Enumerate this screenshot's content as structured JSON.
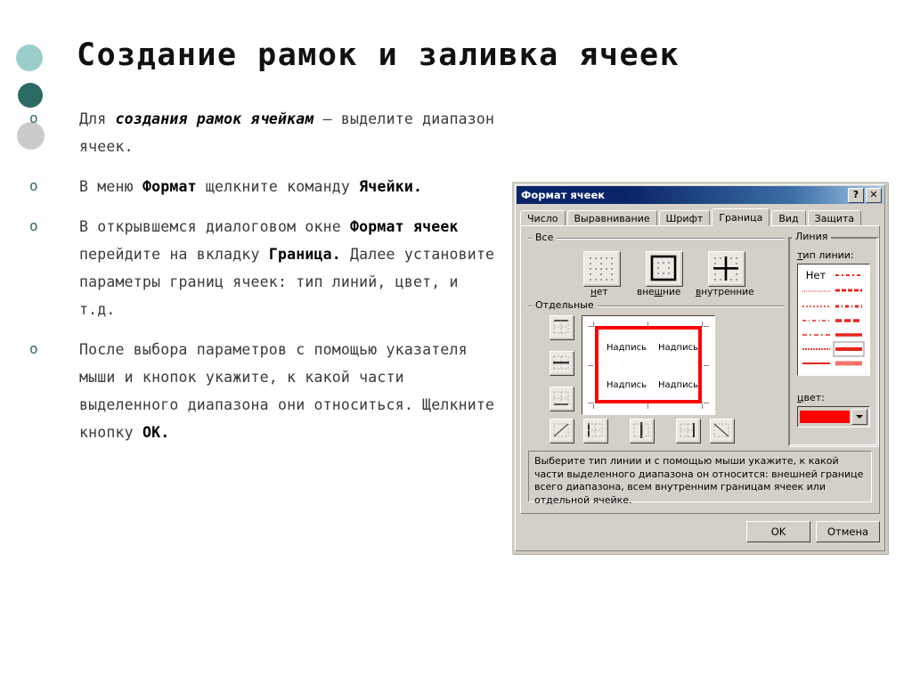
{
  "slide": {
    "title": "Создание рамок и заливка ячеек",
    "bullets": [
      {
        "marker": "o",
        "parts": [
          {
            "t": "Для ",
            "s": "n"
          },
          {
            "t": "создания рамок ячейкам",
            "s": "i"
          },
          {
            "t": " — выделите диапазон ячеек.",
            "s": "n"
          }
        ]
      },
      {
        "marker": "o",
        "parts": [
          {
            "t": "В меню ",
            "s": "n"
          },
          {
            "t": "Формат",
            "s": "b"
          },
          {
            "t": " щелкните команду ",
            "s": "n"
          },
          {
            "t": "Ячейки.",
            "s": "b"
          }
        ]
      },
      {
        "marker": "o",
        "parts": [
          {
            "t": "В открывшемся диалоговом окне ",
            "s": "n"
          },
          {
            "t": "Формат ячеек",
            "s": "b"
          },
          {
            "t": " перейдите на вкладку ",
            "s": "n"
          },
          {
            "t": "Граница.",
            "s": "b"
          },
          {
            "t": " Далее установите параметры границ ячеек: тип линий, цвет, и т.д.",
            "s": "n"
          }
        ]
      },
      {
        "marker": "o",
        "parts": [
          {
            "t": "После выбора параметров с помощью указателя мыши и кнопок укажите, к какой части выделенного диапазона они относиться. Щелкните кнопку ",
            "s": "n"
          },
          {
            "t": "OK.",
            "s": "b"
          }
        ]
      }
    ],
    "decor_colors": [
      "#9ccdcd",
      "#2c6a66",
      "#c9cccb"
    ],
    "bullet_marker_color": "#2c6a66"
  },
  "dialog": {
    "title": "Формат ячеек",
    "titlebar_buttons": [
      {
        "name": "help-button",
        "glyph": "?"
      },
      {
        "name": "close-button",
        "glyph": "✕"
      }
    ],
    "tabs": [
      {
        "label": "Число",
        "active": false
      },
      {
        "label": "Выравнивание",
        "active": false
      },
      {
        "label": "Шрифт",
        "active": false
      },
      {
        "label": "Граница",
        "active": true
      },
      {
        "label": "Вид",
        "active": false
      },
      {
        "label": "Защита",
        "active": false
      }
    ],
    "groups": {
      "all": {
        "label": "Все",
        "presets": [
          {
            "name": "preset-none",
            "label_pre": "",
            "label_u": "н",
            "label_post": "ет",
            "selected": false
          },
          {
            "name": "preset-outline",
            "label_pre": "вне",
            "label_u": "ш",
            "label_post": "ние",
            "selected": false
          },
          {
            "name": "preset-inside",
            "label_pre": "",
            "label_u": "в",
            "label_post": "нутренние",
            "selected": false
          }
        ]
      },
      "separate": {
        "label": "Отдельные",
        "side_buttons": [
          "border-top-button",
          "border-middle-horizontal-button",
          "border-bottom-button"
        ],
        "bottom_buttons": [
          "border-diagonal-up-button",
          "border-left-button",
          "border-middle-vertical-button",
          "border-right-button",
          "border-diagonal-down-button"
        ],
        "preview_labels": [
          "Надпись",
          "Надпись",
          "Надпись",
          "Надпись"
        ],
        "preview_border_color": "#ff0000"
      },
      "line": {
        "label": "Линия",
        "style_label_pre": "",
        "style_label_u": "т",
        "style_label_post": "ип линии:",
        "none_text": "Нет",
        "color_label_u": "ц",
        "color_label_post": "вет:",
        "selected_color": "#ff0000",
        "selected_style_index": 11
      }
    },
    "help_text": "Выберите тип линии и с помощью мыши укажите, к какой части выделенного диапазона он относится: внешней границе всего диапазона, всем внутренним границам ячеек или отдельной ячейке.",
    "buttons": [
      {
        "name": "ok-button",
        "label": "OK"
      },
      {
        "name": "cancel-button",
        "label": "Отмена"
      }
    ]
  }
}
